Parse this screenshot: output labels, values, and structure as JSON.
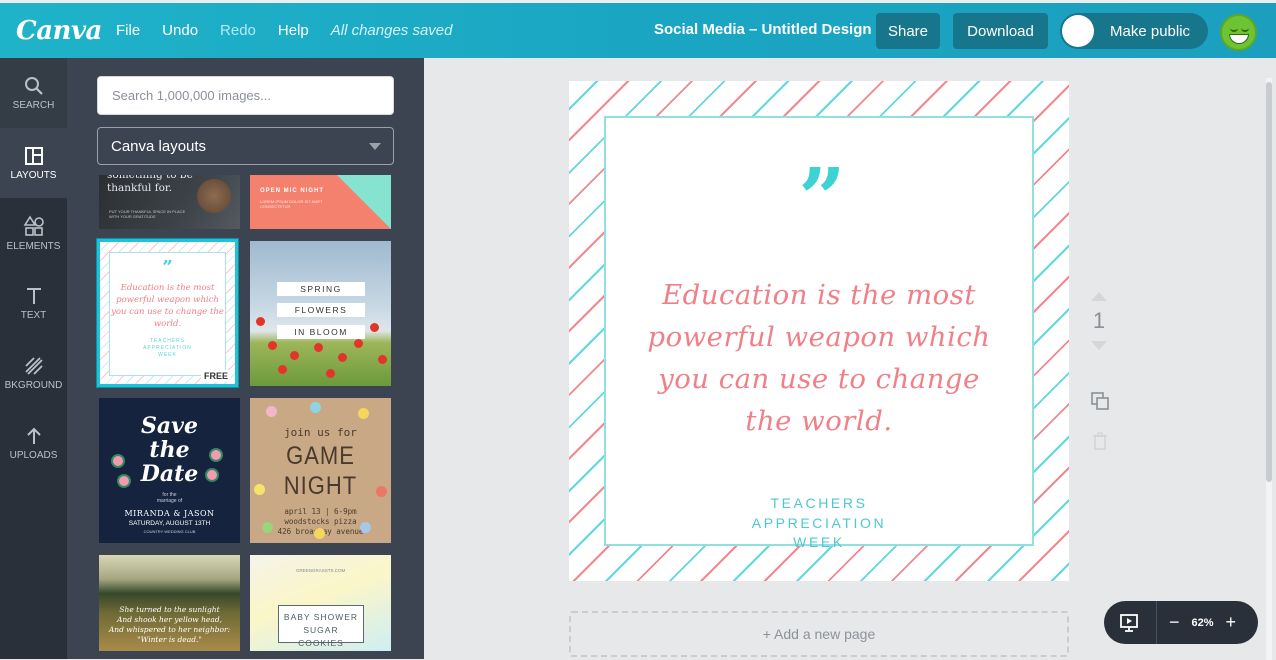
{
  "topbar": {
    "logo": "Canva",
    "menu": [
      {
        "label": "File",
        "dim": false
      },
      {
        "label": "Undo",
        "dim": false
      },
      {
        "label": "Redo",
        "dim": true
      },
      {
        "label": "Help",
        "dim": false
      }
    ],
    "save_status": "All changes saved",
    "doc_title": "Social Media – Untitled Design",
    "share_label": "Share",
    "download_label": "Download",
    "public_label": "Make public",
    "accent": "#1fb3c9"
  },
  "leftnav": {
    "items": [
      {
        "label": "SEARCH",
        "icon": "search-icon"
      },
      {
        "label": "LAYOUTS",
        "icon": "layouts-icon"
      },
      {
        "label": "ELEMENTS",
        "icon": "elements-icon"
      },
      {
        "label": "TEXT",
        "icon": "text-icon"
      },
      {
        "label": "BKGROUND",
        "icon": "background-icon"
      },
      {
        "label": "UPLOADS",
        "icon": "uploads-icon"
      }
    ],
    "active": "LAYOUTS"
  },
  "panel": {
    "search_placeholder": "Search 1,000,000 images...",
    "layouts_select": "Canva layouts",
    "thumbs": {
      "gratitude": {
        "text": "something to be\nthankful for.",
        "small": "PUT YOUR THANKFUL SPACE IN PLACE WITH YOUR GRATITUDE"
      },
      "open_mic": {
        "title": "OPEN MIC NIGHT",
        "sub": "LOREM IPSUM DOLOR SIT AMET CONSECTETUR"
      },
      "education": {
        "text": "Education is the most powerful weapon which you can use to change the world.",
        "foot": "TEACHERS\nAPPRECIATION\nWEEK",
        "badge": "FREE"
      },
      "spring": {
        "lines": [
          "SPRING",
          "FLOWERS",
          "IN BLOOM"
        ]
      },
      "save_date": {
        "title": "Save\nthe\nDate",
        "small": "for the\nmarriage of",
        "names": "MIRANDA & JASON",
        "date": "SATURDAY, AUGUST 13TH",
        "venue": "COUNTRY WEDDING CLUB"
      },
      "game_night": {
        "join": "join us for",
        "title": "GAME NIGHT",
        "details": "april 13 | 6-9pm\nwoodstocks pizza\n426 broadway avenue"
      },
      "sunlight": {
        "text": "She turned to the sunlight\nAnd shook her yellow head,\nAnd whispered to her neighbor:\n\"Winter is dead.\""
      },
      "baby_shower": {
        "url": "GREENGRASSTS.COM",
        "text": "BABY SHOWER\nSUGAR COOKIES"
      }
    }
  },
  "canvas": {
    "quote_mark": "”",
    "quote": "Education is the most powerful weapon which you can use to change the world.",
    "attribution": "TEACHERS\nAPPRECIATION\nWEEK",
    "quote_color": "#f17f87",
    "accent_color": "#3ed3d3"
  },
  "pagenav": {
    "page_number": "1"
  },
  "add_page_label": "+ Add a new page",
  "zoom": {
    "level": "62%",
    "minus": "−",
    "plus": "+"
  }
}
